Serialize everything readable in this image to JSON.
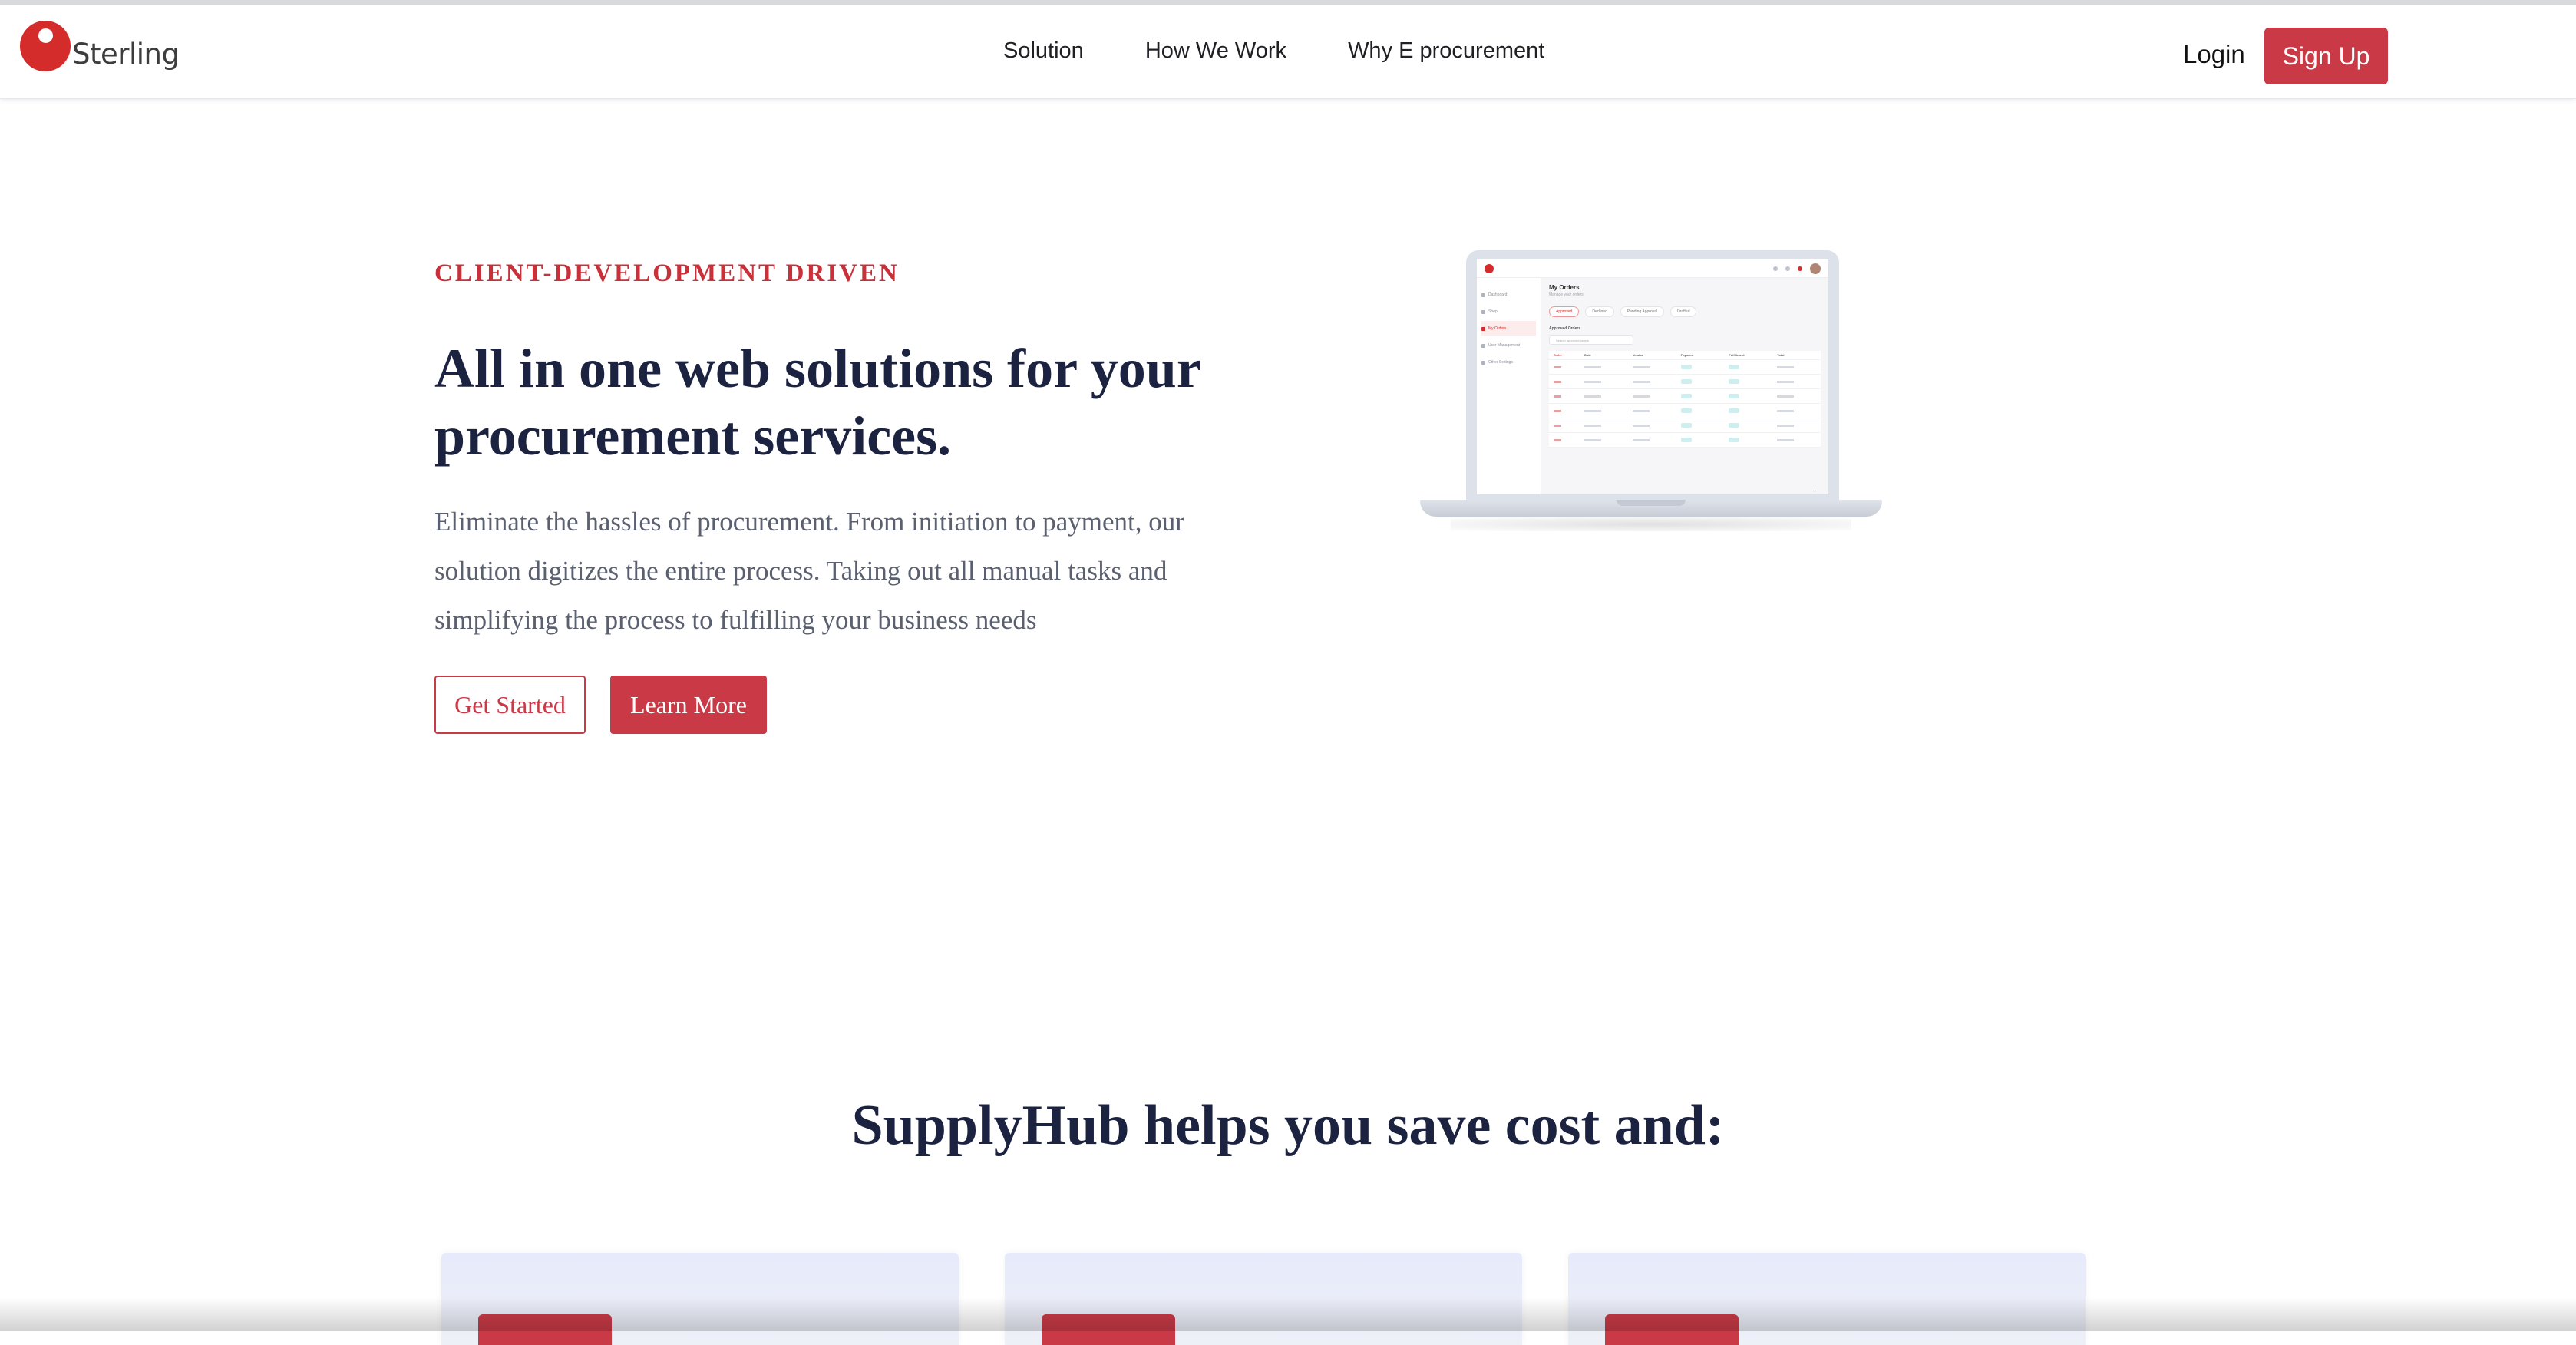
{
  "header": {
    "logo_text": "Sterling",
    "nav": [
      "Solution",
      "How We Work",
      "Why E procurement"
    ],
    "login_label": "Login",
    "signup_label": "Sign Up"
  },
  "hero": {
    "eyebrow": "CLIENT-DEVELOPMENT DRIVEN",
    "title": "All in one web solutions for your procurement services.",
    "description": "Eliminate the hassles of procurement. From initiation to payment, our solution digitizes the entire process. Taking out all manual tasks and simplifying the process to fulfilling your business needs",
    "primary_cta": "Get Started",
    "secondary_cta": "Learn More"
  },
  "mockup": {
    "screen_title": "My Orders",
    "screen_subtitle": "Manage your orders",
    "sidebar": [
      "Dashboard",
      "Shop",
      "My Orders",
      "User Management",
      "Other Settings"
    ],
    "tabs": [
      "Approved",
      "Declined",
      "Pending Approval",
      "Drafted"
    ],
    "section_label": "Approved Orders",
    "search_placeholder": "Search approved orders",
    "columns": [
      "Order",
      "Date",
      "Vendor",
      "Payment",
      "Fulfillment",
      "Total"
    ],
    "row_count": 6
  },
  "section2": {
    "title": "SupplyHub helps you save cost and:"
  },
  "colors": {
    "brand_red": "#c93a46",
    "logo_red": "#d42b2b",
    "navy": "#1c2340",
    "body_text": "#5a6070",
    "card_bg": "#e6eafa"
  },
  "icons": [
    "logo-mark-icon",
    "laptop-mockup"
  ]
}
